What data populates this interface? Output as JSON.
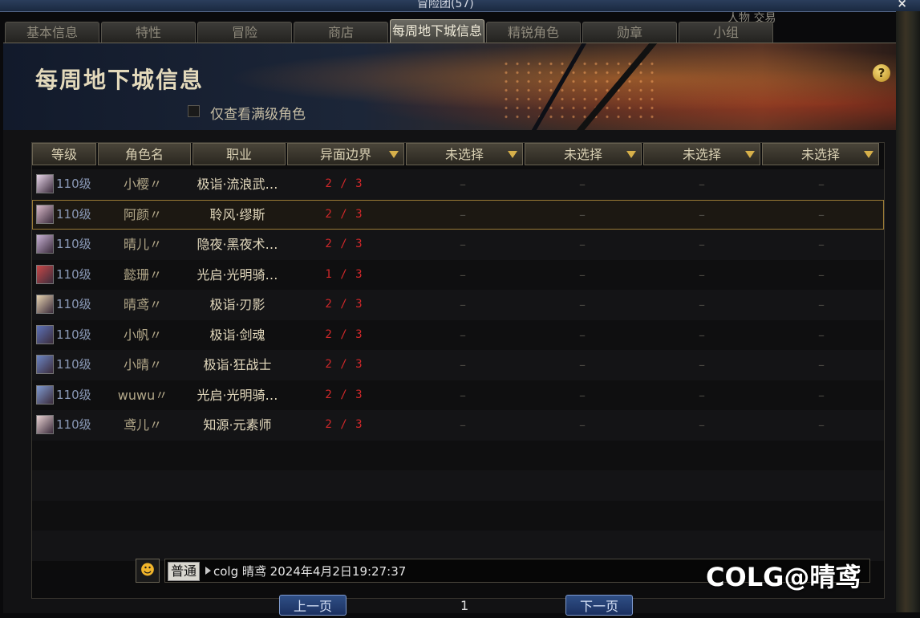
{
  "window": {
    "title": "冒险团(57)",
    "close": "×"
  },
  "background_hint": "人物 交易",
  "tabs": [
    {
      "label": "基本信息"
    },
    {
      "label": "特性"
    },
    {
      "label": "冒险"
    },
    {
      "label": "商店"
    },
    {
      "label": "每周地下城信息",
      "active": true
    },
    {
      "label": "精锐角色"
    },
    {
      "label": "勋章"
    },
    {
      "label": "小组"
    }
  ],
  "page_title": "每周地下城信息",
  "help": "?",
  "filter": {
    "label": "仅查看满级角色",
    "checked": false
  },
  "table": {
    "headers": [
      "等级",
      "角色名",
      "职业",
      "异面边界",
      "未选择",
      "未选择",
      "未选择",
      "未选择"
    ],
    "rows": [
      {
        "level": "110级",
        "name": "小樱〃",
        "job": "极诣·流浪武…",
        "abyss": "2 / 3",
        "c1": "–",
        "c2": "–",
        "c3": "–",
        "c4": "–",
        "avatar_color": "#e9d6ea"
      },
      {
        "level": "110级",
        "name": "阿颜〃",
        "job": "聆风·缪斯",
        "abyss": "2 / 3",
        "c1": "–",
        "c2": "–",
        "c3": "–",
        "c4": "–",
        "avatar_color": "#d9b9c9",
        "selected": true
      },
      {
        "level": "110级",
        "name": "晴儿〃",
        "job": "隐夜·黑夜术…",
        "abyss": "2 / 3",
        "c1": "–",
        "c2": "–",
        "c3": "–",
        "c4": "–",
        "avatar_color": "#c9b2d6"
      },
      {
        "level": "110级",
        "name": "懿珊〃",
        "job": "光启·光明骑…",
        "abyss": "1 / 3",
        "c1": "–",
        "c2": "–",
        "c3": "–",
        "c4": "–",
        "avatar_color": "#c84848"
      },
      {
        "level": "110级",
        "name": "晴鸢〃",
        "job": "极诣·刃影",
        "abyss": "2 / 3",
        "c1": "–",
        "c2": "–",
        "c3": "–",
        "c4": "–",
        "avatar_color": "#e8d4b0"
      },
      {
        "level": "110级",
        "name": "小帆〃",
        "job": "极诣·剑魂",
        "abyss": "2 / 3",
        "c1": "–",
        "c2": "–",
        "c3": "–",
        "c4": "–",
        "avatar_color": "#5d73b8"
      },
      {
        "level": "110级",
        "name": "小晴〃",
        "job": "极诣·狂战士",
        "abyss": "2 / 3",
        "c1": "–",
        "c2": "–",
        "c3": "–",
        "c4": "–",
        "avatar_color": "#6c86c4"
      },
      {
        "level": "110级",
        "name": "wuwu〃",
        "job": "光启·光明骑…",
        "abyss": "2 / 3",
        "c1": "–",
        "c2": "–",
        "c3": "–",
        "c4": "–",
        "avatar_color": "#7f9ad0"
      },
      {
        "level": "110级",
        "name": "鸢儿〃",
        "job": "知源·元素师",
        "abyss": "2 / 3",
        "c1": "–",
        "c2": "–",
        "c3": "–",
        "c4": "–",
        "avatar_color": "#ead3d3"
      }
    ]
  },
  "chat": {
    "channel": "普通",
    "text": "colg 晴鸢 2024年4月2日19:27:37"
  },
  "pager": {
    "prev": "上一页",
    "page": "1",
    "next": "下一页"
  },
  "watermark": "COLG@晴鸢",
  "colors": {
    "abyss_red": "#d0282a",
    "header_arrow": "#d7b04a",
    "selected_outline": "#9a7a35"
  }
}
